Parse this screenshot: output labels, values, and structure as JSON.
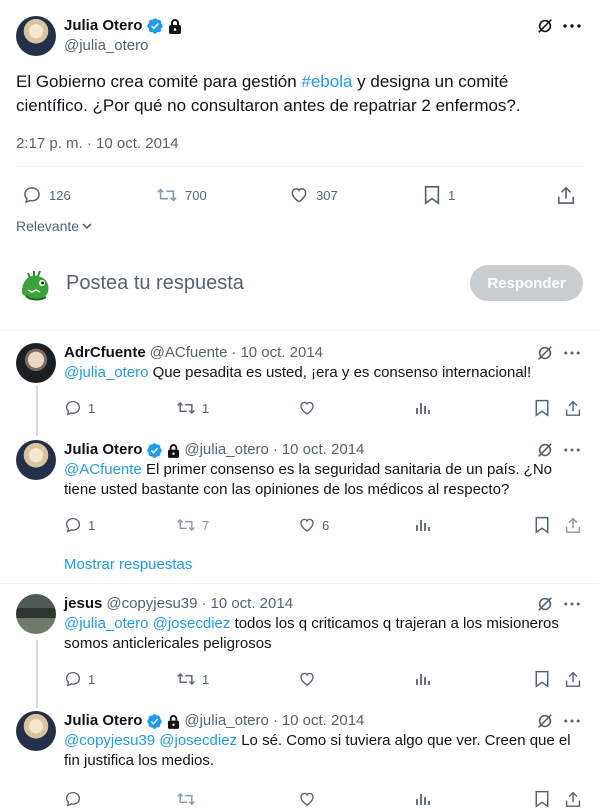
{
  "main_tweet": {
    "name": "Julia Otero",
    "handle": "@julia_otero",
    "text_before": "El Gobierno crea comité para gestión ",
    "hashtag": "#ebola",
    "text_after": " y designa un comité científico. ¿Por qué no consultaron antes de repatriar 2 enfermos?.",
    "timestamp": "2:17 p. m. · 10 oct. 2014",
    "replies": "126",
    "retweets": "700",
    "likes": "307",
    "bookmarks": "1"
  },
  "sort_label": "Relevante",
  "compose": {
    "placeholder": "Postea tu respuesta",
    "button": "Responder"
  },
  "replies": [
    {
      "name": "AdrCfuente",
      "handle": "@ACfuente",
      "date": "10 oct. 2014",
      "mention": "@julia_otero",
      "text": " Que pesadita es usted, ¡era y es consenso internacional!",
      "replies": "1",
      "retweets": "1",
      "likes": ""
    },
    {
      "name": "Julia Otero",
      "handle": "@julia_otero",
      "date": "10 oct. 2014",
      "mention": "@ACfuente",
      "text": " El primer consenso es la seguridad sanitaria de un país. ¿No tiene usted bastante con las opiniones de los médicos al respecto?",
      "replies": "1",
      "retweets": "7",
      "likes": "6"
    },
    {
      "name": "jesus",
      "handle": "@copyjesu39",
      "date": "10 oct. 2014",
      "mention": "@julia_otero @josecdiez",
      "text": " todos los q criticamos q trajeran a los misioneros somos anticlericales peligrosos",
      "replies": "1",
      "retweets": "1",
      "likes": ""
    },
    {
      "name": "Julia Otero",
      "handle": "@julia_otero",
      "date": "10 oct. 2014",
      "mention": "@copyjesu39 @josecdiez",
      "text": " Lo sé. Como si tuviera algo que ver. Creen que el fin justifica los medios.",
      "replies": "",
      "retweets": "",
      "likes": ""
    }
  ],
  "show_replies": "Mostrar respuestas",
  "separator": "·",
  "colors": {
    "accent": "#1d9bf0",
    "muted": "#536471",
    "verified": "#1d9bf0",
    "button_disabled": "#8ecdf8"
  }
}
